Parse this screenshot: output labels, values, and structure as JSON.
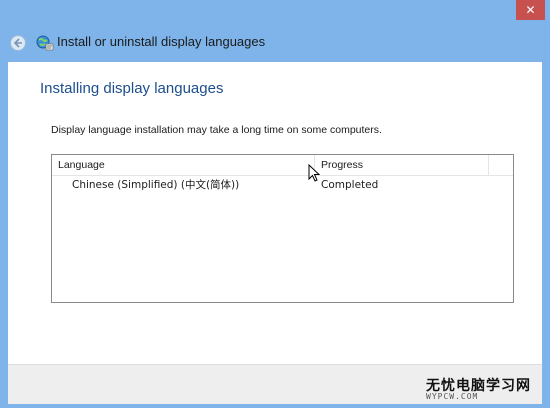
{
  "window": {
    "close_glyph": "✕"
  },
  "navbar": {
    "title": "Install or uninstall display languages",
    "back_icon": "back-arrow-icon",
    "app_icon": "globe-language-icon"
  },
  "main": {
    "heading": "Installing display languages",
    "description": "Display language installation may take a long time on some computers.",
    "table": {
      "columns": [
        "Language",
        "Progress"
      ],
      "rows": [
        {
          "language": "Chinese (Simplified) (中文(简体))",
          "progress": "Completed"
        }
      ]
    }
  },
  "watermark": {
    "text": "无忧电脑学习网",
    "subtext": "WYPCW.COM"
  },
  "colors": {
    "frame": "#7eb4ea",
    "close": "#c7514f",
    "heading": "#1e4e8c",
    "content_bg": "#ffffff",
    "footer_bg": "#eeeeee"
  }
}
